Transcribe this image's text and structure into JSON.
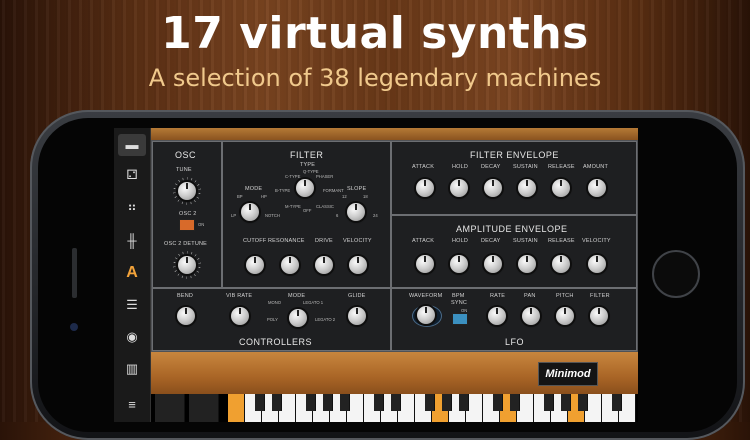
{
  "headline": "17 virtual synths",
  "subheadline": "A selection of 38 legendary machines",
  "sidebar": {
    "letter": "A"
  },
  "osc": {
    "title": "OSC",
    "tune": "TUNE",
    "osc2": "OSC 2",
    "on": "ON",
    "detune": "OSC 2 DETUNE"
  },
  "filter": {
    "title": "FILTER",
    "type": "TYPE",
    "mode": "MODE",
    "slope": "SLOPE",
    "cutoff": "CUTOFF",
    "resonance": "RESONANCE",
    "drive": "DRIVE",
    "velocity": "VELOCITY",
    "type_opts": {
      "qtype": "Q-TYPE",
      "ctype": "C-TYPE",
      "phaser": "PHASER",
      "btype": "B-TYPE",
      "formant": "FORMANT",
      "mtype": "M-TYPE",
      "classic": "CLASSIC",
      "off": "OFF"
    },
    "mode_opts": {
      "bp": "BP",
      "hp": "HP",
      "lp": "LP",
      "notch": "NOTCH"
    },
    "slope_opts": {
      "s12": "12",
      "s18": "18",
      "s6": "6",
      "s24": "24"
    }
  },
  "filter_env": {
    "title": "FILTER ENVELOPE",
    "attack": "ATTACK",
    "hold": "HOLD",
    "decay": "DECAY",
    "sustain": "SUSTAIN",
    "release": "RELEASE",
    "amount": "AMOUNT"
  },
  "amp_env": {
    "title": "AMPLITUDE ENVELOPE",
    "attack": "ATTACK",
    "hold": "HOLD",
    "decay": "DECAY",
    "sustain": "SUSTAIN",
    "release": "RELEASE",
    "velocity": "VELOCITY"
  },
  "controllers": {
    "title": "CONTROLLERS",
    "bend": "BEND",
    "vib_rate": "VIB RATE",
    "mode": "MODE",
    "glide": "GLIDE",
    "mode_opts": {
      "mono": "MONO",
      "legato1": "LEGATO 1",
      "poly": "POLY",
      "legato2": "LEGATO 2"
    }
  },
  "lfo": {
    "title": "LFO",
    "waveform": "WAVEFORM",
    "bpm_sync_1": "BPM",
    "bpm_sync_2": "SYNC",
    "on": "ON",
    "rate": "RATE",
    "pan": "PAN",
    "pitch": "PITCH",
    "filter": "FILTER"
  },
  "instrument_name": "Minimod",
  "colors": {
    "accent_orange": "#f0a030",
    "toggle_red": "#d86a2a",
    "toggle_blue": "#3b90c0"
  }
}
